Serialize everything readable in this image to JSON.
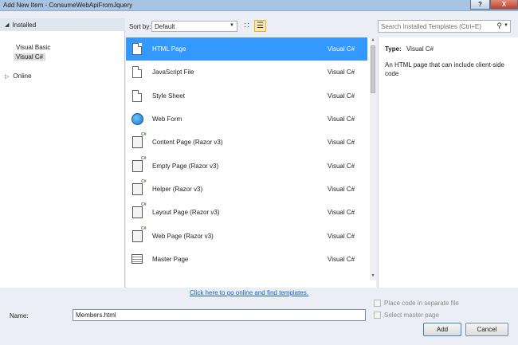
{
  "window": {
    "title": "Add New Item - ConsumeWebApiFromJquery",
    "help_label": "?",
    "close_label": "X"
  },
  "tree": {
    "installed_label": "Installed",
    "items": [
      "Visual Basic",
      "Visual C#"
    ],
    "selected": "Visual C#",
    "online_label": "Online"
  },
  "toolbar": {
    "sort_label": "Sort by:",
    "sort_value": "Default",
    "search_placeholder": "Search Installed Templates (Ctrl+E)"
  },
  "templates": [
    {
      "name": "HTML Page",
      "lang": "Visual C#",
      "icon": "html-page-icon",
      "selected": true
    },
    {
      "name": "JavaScript File",
      "lang": "Visual C#",
      "icon": "javascript-file-icon"
    },
    {
      "name": "Style Sheet",
      "lang": "Visual C#",
      "icon": "style-sheet-icon"
    },
    {
      "name": "Web Form",
      "lang": "Visual C#",
      "icon": "globe-icon"
    },
    {
      "name": "Content Page (Razor v3)",
      "lang": "Visual C#",
      "icon": "razor-page-icon"
    },
    {
      "name": "Empty Page (Razor v3)",
      "lang": "Visual C#",
      "icon": "razor-page-icon"
    },
    {
      "name": "Helper (Razor v3)",
      "lang": "Visual C#",
      "icon": "razor-page-icon"
    },
    {
      "name": "Layout Page (Razor v3)",
      "lang": "Visual C#",
      "icon": "razor-page-icon"
    },
    {
      "name": "Web Page (Razor v3)",
      "lang": "Visual C#",
      "icon": "razor-page-icon"
    },
    {
      "name": "Master Page",
      "lang": "Visual C#",
      "icon": "master-page-icon"
    }
  ],
  "online_link": "Click here to go online and find templates.",
  "details": {
    "type_label": "Type:",
    "type_value": "Visual C#",
    "description": "An HTML page that can include client-side code"
  },
  "bottom": {
    "name_label": "Name:",
    "name_value": "Members.html",
    "separate_file_label": "Place code in separate file",
    "master_page_label": "Select master page",
    "add_label": "Add",
    "cancel_label": "Cancel"
  },
  "colors": {
    "selection": "#3399ff",
    "link": "#1a5fc8",
    "titlebar": "#a8c4e2"
  }
}
